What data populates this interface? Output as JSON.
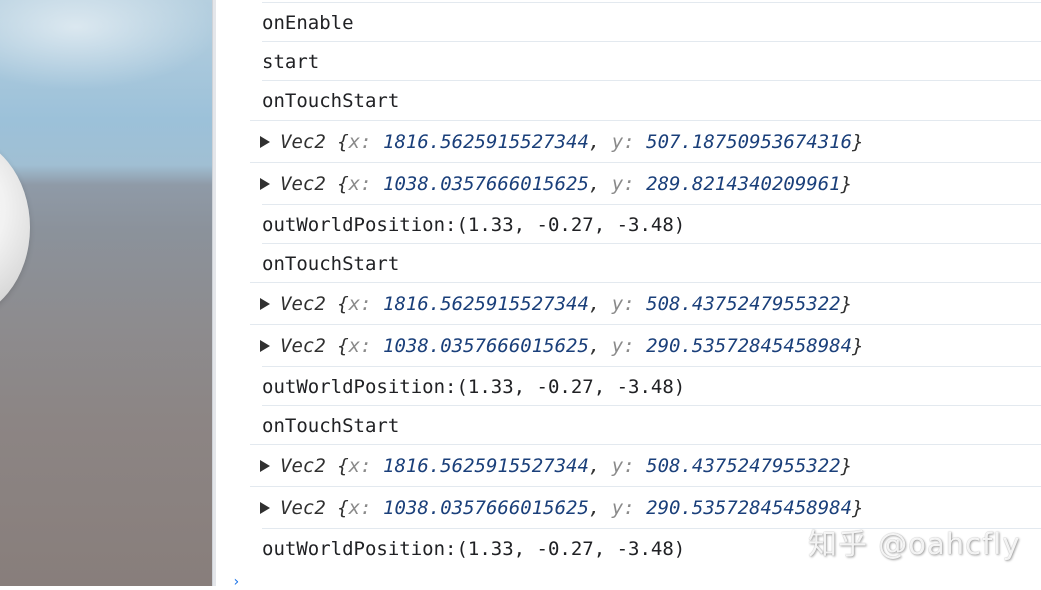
{
  "console_lines": [
    {
      "kind": "text",
      "text": "onEnable"
    },
    {
      "kind": "text",
      "text": "start"
    },
    {
      "kind": "text",
      "text": "onTouchStart"
    },
    {
      "kind": "object",
      "cls": "Vec2",
      "x": "1816.5625915527344",
      "y": "507.18750953674316"
    },
    {
      "kind": "object",
      "cls": "Vec2",
      "x": "1038.0357666015625",
      "y": "289.8214340209961"
    },
    {
      "kind": "text",
      "text": "outWorldPosition:(1.33, -0.27, -3.48)"
    },
    {
      "kind": "text",
      "text": "onTouchStart"
    },
    {
      "kind": "object",
      "cls": "Vec2",
      "x": "1816.5625915527344",
      "y": "508.4375247955322"
    },
    {
      "kind": "object",
      "cls": "Vec2",
      "x": "1038.0357666015625",
      "y": "290.53572845458984"
    },
    {
      "kind": "text",
      "text": "outWorldPosition:(1.33, -0.27, -3.48)"
    },
    {
      "kind": "text",
      "text": "onTouchStart"
    },
    {
      "kind": "object",
      "cls": "Vec2",
      "x": "1816.5625915527344",
      "y": "508.4375247955322"
    },
    {
      "kind": "object",
      "cls": "Vec2",
      "x": "1038.0357666015625",
      "y": "290.53572845458984"
    },
    {
      "kind": "text",
      "text": "outWorldPosition:(1.33, -0.27, -3.48)"
    }
  ],
  "labels": {
    "key_x": "x",
    "key_y": "y",
    "prompt": "›"
  },
  "watermark": "知乎 @oahcfly",
  "colors": {
    "key": "#8a8a8a",
    "number": "#1a3f7a",
    "text": "#202124",
    "row_border": "#e3e9ef"
  },
  "icons": {
    "expand": "triangle-right-icon",
    "prompt": "chevron-right-icon"
  }
}
